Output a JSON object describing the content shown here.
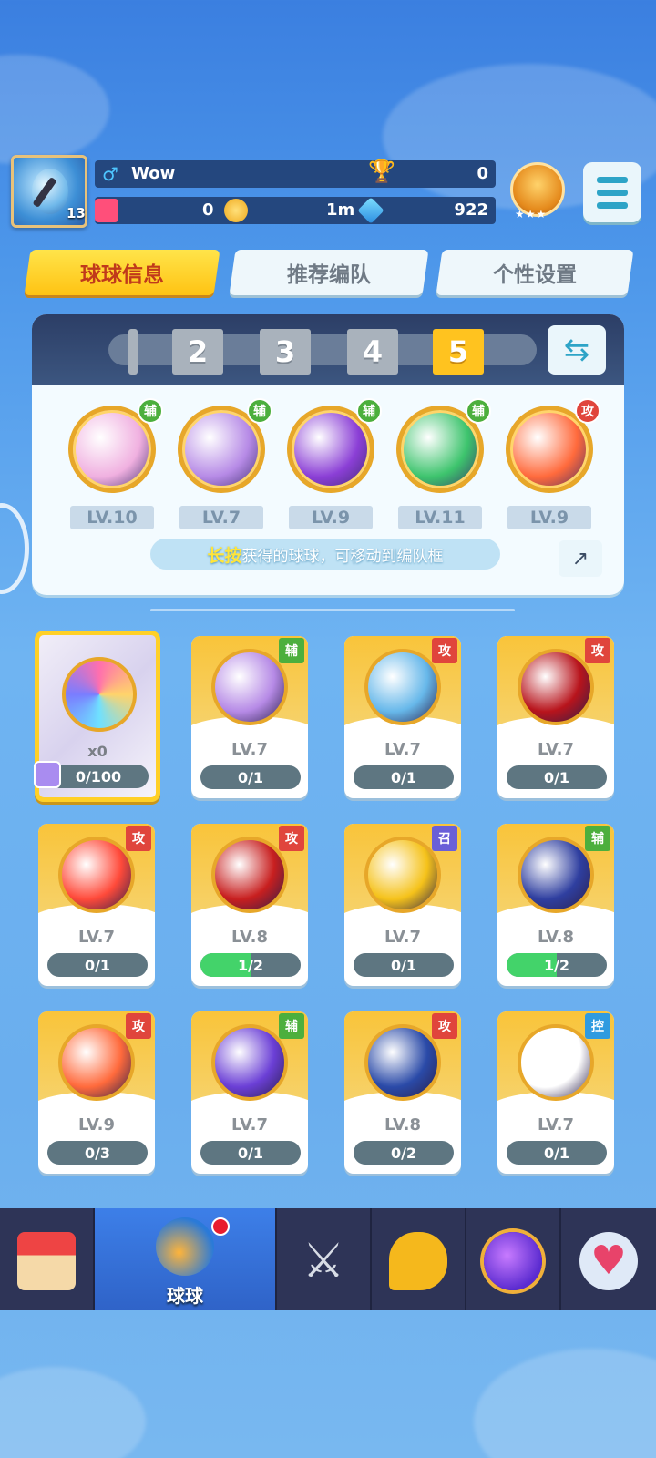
{
  "player": {
    "name": "Wow",
    "level": "13",
    "trophies": "0",
    "tickets": "0",
    "gold": "1m",
    "diamonds": "922",
    "rank_stars": "★★★"
  },
  "tabs": [
    {
      "label": "球球信息",
      "active": true
    },
    {
      "label": "推荐编队",
      "active": false
    },
    {
      "label": "个性设置",
      "active": false
    }
  ],
  "team": {
    "slots": [
      "2",
      "3",
      "4",
      "5"
    ],
    "active_slot": "5",
    "members": [
      {
        "type": "辅",
        "level": "LV.10",
        "color": "#f0b0e0"
      },
      {
        "type": "辅",
        "level": "LV.7",
        "color": "#b68ae6"
      },
      {
        "type": "辅",
        "level": "LV.9",
        "color": "#8b3fd6"
      },
      {
        "type": "辅",
        "level": "LV.11",
        "color": "#3dc46d"
      },
      {
        "type": "攻",
        "level": "LV.9",
        "color": "#ff6a3c"
      }
    ],
    "hint_key": "长按",
    "hint_text": "获得的球球，可移动到编队框"
  },
  "special_card": {
    "count": "x0",
    "progress": "0/100"
  },
  "cards": [
    {
      "type": "辅",
      "level": "LV.7",
      "progress": "0/1",
      "fill": 0,
      "color": "#b68ae6"
    },
    {
      "type": "攻",
      "level": "LV.7",
      "progress": "0/1",
      "fill": 0,
      "color": "#67b8ea"
    },
    {
      "type": "攻",
      "level": "LV.7",
      "progress": "0/1",
      "fill": 0,
      "color": "#b8141c"
    },
    {
      "type": "攻",
      "level": "LV.7",
      "progress": "0/1",
      "fill": 0,
      "color": "#ff4a3a"
    },
    {
      "type": "攻",
      "level": "LV.8",
      "progress": "1/2",
      "fill": 0.5,
      "color": "#c81f1f"
    },
    {
      "type": "召",
      "level": "LV.7",
      "progress": "0/1",
      "fill": 0,
      "color": "#f5c21a"
    },
    {
      "type": "辅",
      "level": "LV.8",
      "progress": "1/2",
      "fill": 0.5,
      "color": "#2f3fa0"
    },
    {
      "type": "攻",
      "level": "LV.9",
      "progress": "0/3",
      "fill": 0,
      "color": "#ff6a3c"
    },
    {
      "type": "辅",
      "level": "LV.7",
      "progress": "0/1",
      "fill": 0,
      "color": "#6b3fd6"
    },
    {
      "type": "攻",
      "level": "LV.8",
      "progress": "0/2",
      "fill": 0,
      "color": "#2a4aa8"
    },
    {
      "type": "控",
      "level": "LV.7",
      "progress": "0/1",
      "fill": 0,
      "color": "#ffffff"
    }
  ],
  "type_colors": {
    "辅": "#4caf3d",
    "攻": "#e0453c",
    "召": "#6a5fd8",
    "控": "#2f9be0"
  },
  "nav": {
    "active_label": "球球"
  }
}
